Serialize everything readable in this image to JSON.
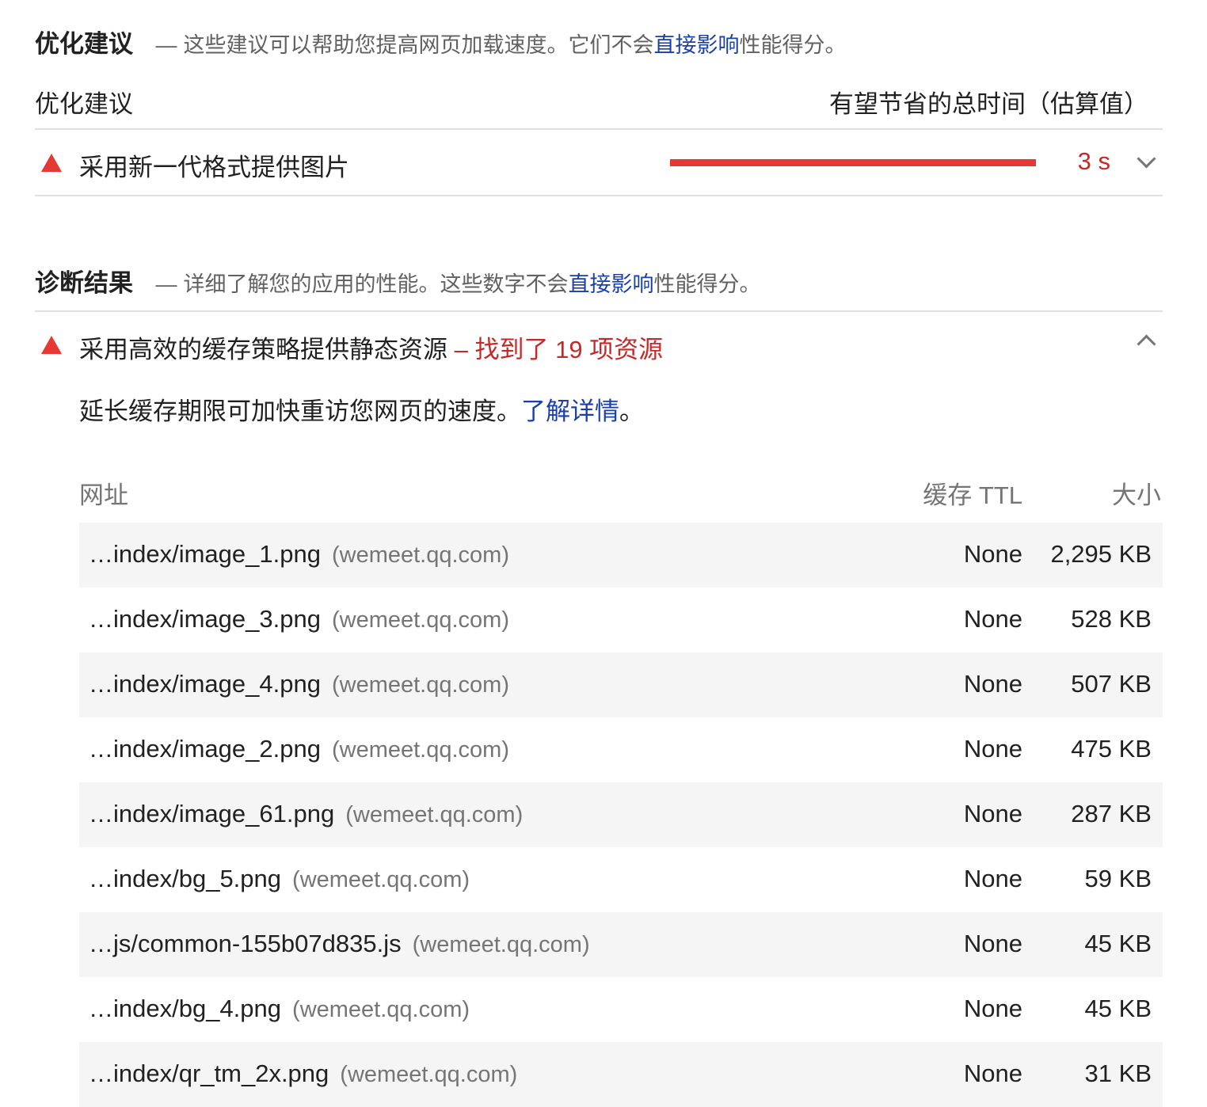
{
  "opportunities": {
    "title": "优化建议",
    "desc_prefix": "这些建议可以帮助您提高网页加载速度。它们不会",
    "desc_link": "直接影响",
    "desc_suffix": "性能得分。",
    "col_left": "优化建议",
    "col_right": "有望节省的总时间（估算值）",
    "items": [
      {
        "title": "采用新一代格式提供图片",
        "savings_text": "3 s",
        "savings_fraction": 1.0
      }
    ]
  },
  "diagnostics": {
    "title": "诊断结果",
    "desc_prefix": "详细了解您的应用的性能。这些数字不会",
    "desc_link": "直接影响",
    "desc_suffix": "性能得分。",
    "audit": {
      "title": "采用高效的缓存策略提供静态资源",
      "display_value": "找到了 19 项资源",
      "description": "延长缓存期限可加快重访您网页的速度。",
      "learn_more": "了解详情",
      "learn_more_suffix": "。",
      "table": {
        "headers": {
          "url": "网址",
          "ttl": "缓存 TTL",
          "size": "大小"
        },
        "rows": [
          {
            "url": "…index/image_1.png",
            "host": "(wemeet.qq.com)",
            "ttl": "None",
            "size": "2,295 KB"
          },
          {
            "url": "…index/image_3.png",
            "host": "(wemeet.qq.com)",
            "ttl": "None",
            "size": "528 KB"
          },
          {
            "url": "…index/image_4.png",
            "host": "(wemeet.qq.com)",
            "ttl": "None",
            "size": "507 KB"
          },
          {
            "url": "…index/image_2.png",
            "host": "(wemeet.qq.com)",
            "ttl": "None",
            "size": "475 KB"
          },
          {
            "url": "…index/image_61.png",
            "host": "(wemeet.qq.com)",
            "ttl": "None",
            "size": "287 KB"
          },
          {
            "url": "…index/bg_5.png",
            "host": "(wemeet.qq.com)",
            "ttl": "None",
            "size": "59 KB"
          },
          {
            "url": "…js/common-155b07d835.js",
            "host": "(wemeet.qq.com)",
            "ttl": "None",
            "size": "45 KB"
          },
          {
            "url": "…index/bg_4.png",
            "host": "(wemeet.qq.com)",
            "ttl": "None",
            "size": "45 KB"
          },
          {
            "url": "…index/qr_tm_2x.png",
            "host": "(wemeet.qq.com)",
            "ttl": "None",
            "size": "31 KB"
          }
        ]
      }
    }
  },
  "icons": {
    "warning": "warning-triangle-icon",
    "expand": "chevron-down-icon",
    "collapse": "chevron-up-icon"
  },
  "colors": {
    "fail_red": "#e53935",
    "fail_text": "#c62828",
    "link_blue": "#1a3fa8",
    "row_shade": "#f5f5f5"
  }
}
